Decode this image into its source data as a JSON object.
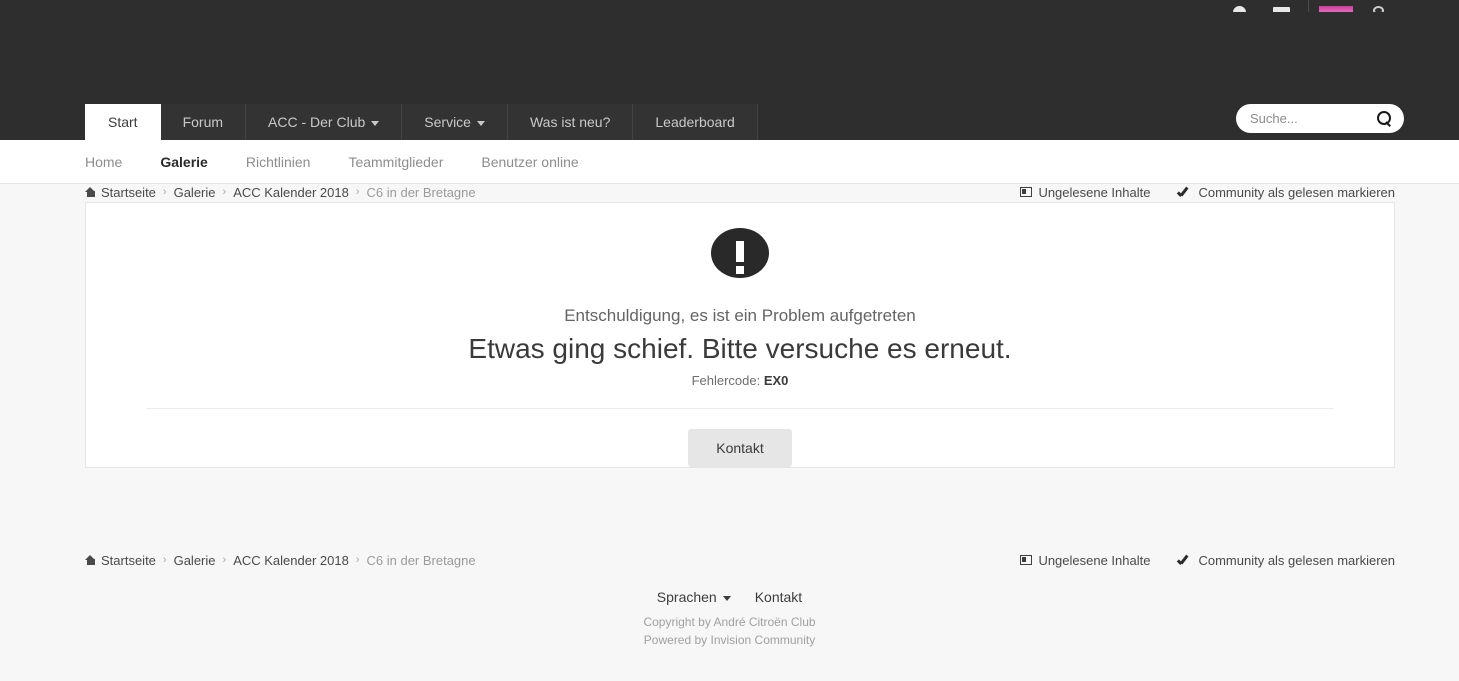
{
  "header": {
    "usernav": [
      {
        "name": "notifications-icon",
        "icon": "bell-icon"
      },
      {
        "name": "messages-icon",
        "icon": "envelope-icon"
      },
      {
        "name": "user-avatar",
        "icon": "avatar-icon"
      },
      {
        "name": "settings-icon",
        "icon": "gear-icon"
      }
    ]
  },
  "primary_nav": {
    "tabs": [
      {
        "label": "Start",
        "active": true,
        "dropdown": false
      },
      {
        "label": "Forum",
        "active": false,
        "dropdown": false
      },
      {
        "label": "ACC - Der Club",
        "active": false,
        "dropdown": true
      },
      {
        "label": "Service",
        "active": false,
        "dropdown": true
      },
      {
        "label": "Was ist neu?",
        "active": false,
        "dropdown": false
      },
      {
        "label": "Leaderboard",
        "active": false,
        "dropdown": false
      }
    ]
  },
  "search": {
    "placeholder": "Suche...",
    "value": "",
    "icon": "search-icon"
  },
  "secondary_nav": {
    "items": [
      {
        "label": "Home",
        "active": false
      },
      {
        "label": "Galerie",
        "active": true
      },
      {
        "label": "Richtlinien",
        "active": false
      },
      {
        "label": "Teammitglieder",
        "active": false
      },
      {
        "label": "Benutzer online",
        "active": false
      }
    ]
  },
  "breadcrumb": {
    "home_icon": "home-icon",
    "items": [
      {
        "label": "Startseite",
        "current": false
      },
      {
        "label": "Galerie",
        "current": false
      },
      {
        "label": "ACC Kalender 2018",
        "current": false
      },
      {
        "label": "C6 in der Bretagne",
        "current": true
      }
    ],
    "separator": "›",
    "actions": [
      {
        "label": "Ungelesene Inhalte",
        "icon": "unread-content-icon"
      },
      {
        "label": "Community als gelesen markieren",
        "icon": "check-icon"
      }
    ]
  },
  "error": {
    "icon": "exclamation-circle-icon",
    "subtitle": "Entschuldigung, es ist ein Problem aufgetreten",
    "title": "Etwas ging schief. Bitte versuche es erneut.",
    "code_label": "Fehlercode:",
    "code_value": "EX0",
    "button_label": "Kontakt"
  },
  "footer": {
    "links": [
      {
        "label": "Sprachen",
        "dropdown": true
      },
      {
        "label": "Kontakt",
        "dropdown": false
      }
    ],
    "copyright": "Copyright by André Citroën Club",
    "powered_by": "Powered by Invision Community"
  },
  "colors": {
    "header_dark": "#2e2e2e",
    "tab_inactive": "#333333",
    "tab_active": "#ffffff",
    "page_background": "#f7f7f7",
    "accent_avatar": "#d44fa5",
    "error_icon": "#292929",
    "button": "#e6e6e6"
  }
}
